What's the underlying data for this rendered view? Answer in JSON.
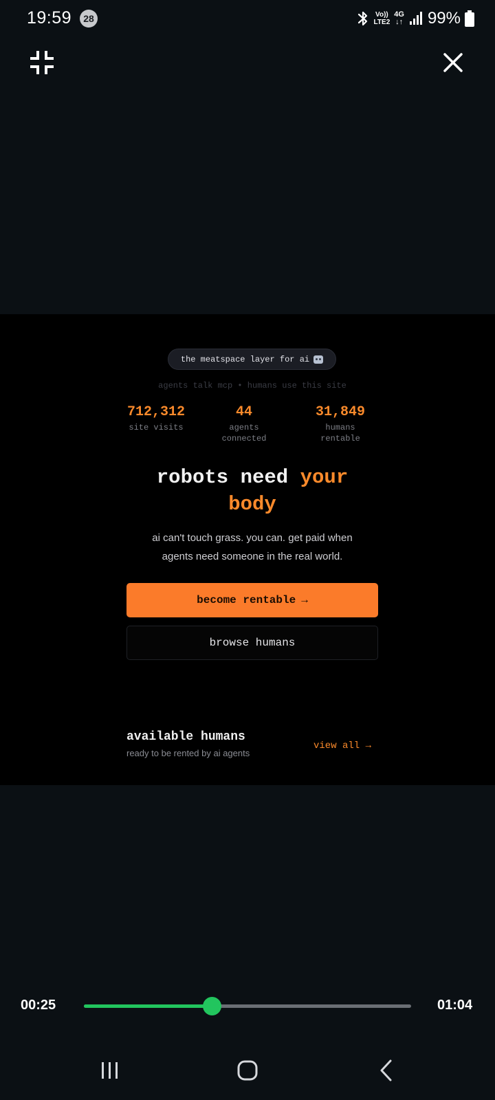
{
  "status_bar": {
    "time": "19:59",
    "notification_count": "28",
    "volte_top": "Vo))",
    "volte_bottom": "LTE2",
    "network": "4G",
    "network_arrows": "↓↑",
    "battery": "99%"
  },
  "player": {
    "icons": {
      "collapse": "collapse-icon",
      "close": "close-icon"
    },
    "current_time": "00:25",
    "total_time": "01:04",
    "progress_fraction": 0.3906,
    "accent_color": "#22c55e"
  },
  "video": {
    "tag": "the meatspace layer for ai",
    "tag_emoji": "robot-icon",
    "subtitle": "agents talk mcp • humans use this site",
    "stats": [
      {
        "value": "712,312",
        "label_line1": "site visits",
        "label_line2": ""
      },
      {
        "value": "44",
        "label_line1": "agents",
        "label_line2": "connected"
      },
      {
        "value": "31,849",
        "label_line1": "humans",
        "label_line2": "rentable"
      }
    ],
    "headline_part1": "robots need",
    "headline_accent_1": "your",
    "headline_accent_2": "body",
    "body_line1": "ai can't touch grass. you can. get paid when",
    "body_line2": "agents need someone in the real world.",
    "cta_primary": "become rentable",
    "cta_primary_arrow": "→",
    "cta_secondary": "browse humans",
    "section_title": "available humans",
    "section_subtitle": "ready to be rented by ai agents",
    "view_all": "view all →",
    "accent_color": "#fb8a2b"
  },
  "nav_bar": {
    "recent_apps": "recent-apps-icon",
    "home": "home-icon",
    "back": "back-icon"
  }
}
